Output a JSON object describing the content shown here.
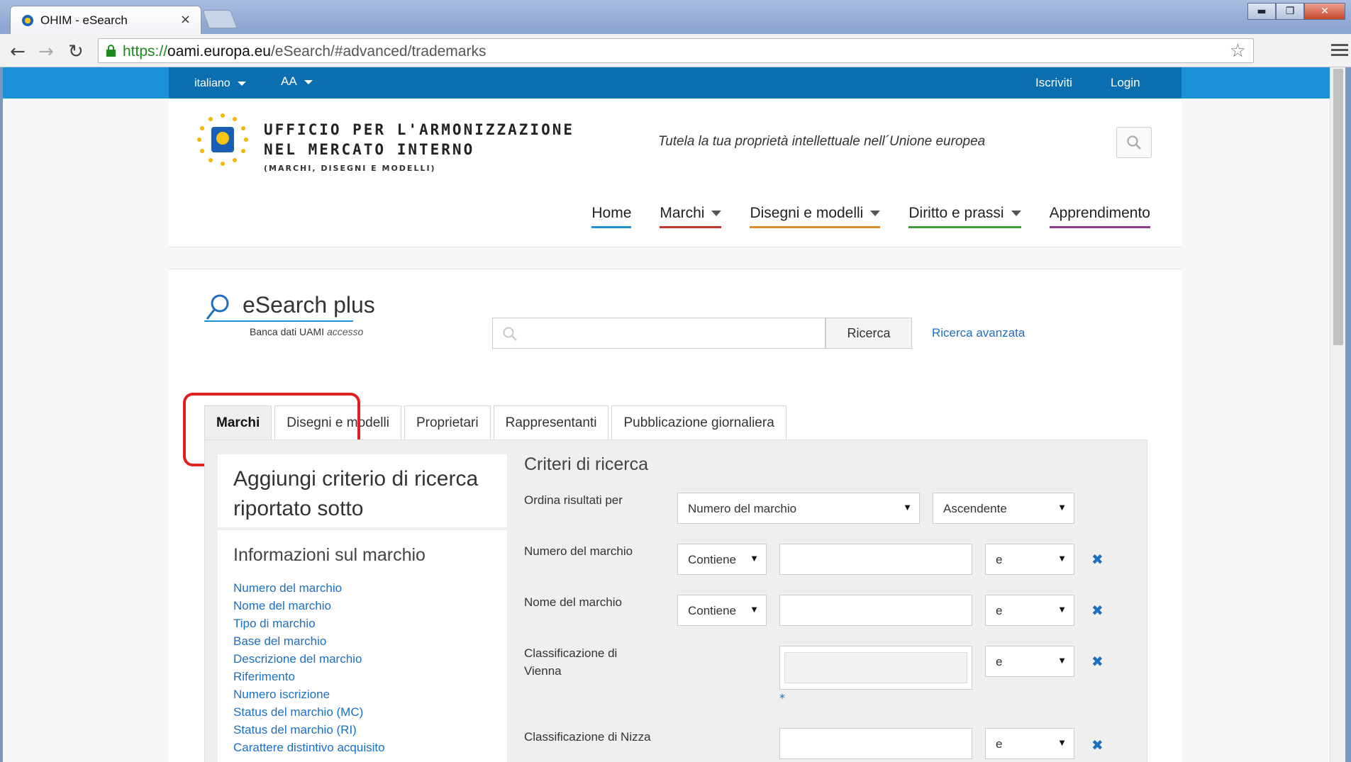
{
  "browser": {
    "tab_title": "OHIM - eSearch",
    "tab_close": "×",
    "url_scheme": "https://",
    "url_host": "oami.europa.eu",
    "url_path": "/eSearch/#advanced/trademarks",
    "window_minimize": "▬",
    "window_maximize": "❐",
    "window_close": "✕"
  },
  "topbar": {
    "language": "italiano",
    "font_size": "AA",
    "register": "Iscriviti",
    "login": "Login"
  },
  "header": {
    "org_line1": "UFFICIO PER L'ARMONIZZAZIONE",
    "org_line2": "NEL MERCATO INTERNO",
    "org_sub": "(MARCHI, DISEGNI E MODELLI)",
    "tagline": "Tutela la tua proprietà intellettuale nell´Unione europea",
    "nav": [
      {
        "label": "Home",
        "color": "#1d8fd2"
      },
      {
        "label": "Marchi",
        "color": "#c0392b"
      },
      {
        "label": "Disegni e modelli",
        "color": "#e08b2a"
      },
      {
        "label": "Diritto e prassi",
        "color": "#3f9e3a"
      },
      {
        "label": "Apprendimento",
        "color": "#8e3c8c"
      }
    ]
  },
  "esearch": {
    "title": "eSearch plus",
    "sub_main": "Banca dati UAMI ",
    "sub_italic": "accesso",
    "search_button": "Ricerca",
    "advanced_link": "Ricerca avanzata"
  },
  "tabs": [
    "Marchi",
    "Disegni e modelli",
    "Proprietari",
    "Rappresentanti",
    "Pubblicazione giornaliera"
  ],
  "left_panel": {
    "add_title": "Aggiungi criterio di ricerca riportato sotto",
    "info_title": "Informazioni sul marchio",
    "items": [
      "Numero del marchio",
      "Nome del marchio",
      "Tipo di marchio",
      "Base del marchio",
      "Descrizione del marchio",
      "Riferimento",
      "Numero iscrizione",
      "Status del marchio (MC)",
      "Status del marchio (RI)",
      "Carattere distintivo acquisito"
    ]
  },
  "criteria": {
    "title": "Criteri di ricerca",
    "sort_label": "Ordina risultati per",
    "sort_field": "Numero del marchio",
    "sort_order": "Ascendente",
    "arrow": "▼",
    "remove": "✖",
    "rows": [
      {
        "label": "Numero del marchio",
        "op": "Contiene",
        "logic": "e"
      },
      {
        "label": "Nome del marchio",
        "op": "Contiene",
        "logic": "e"
      },
      {
        "label": "Classificazione di Vienna",
        "logic": "e",
        "asterisk": "*"
      },
      {
        "label": "Classificazione di Nizza",
        "logic": "e"
      }
    ]
  }
}
